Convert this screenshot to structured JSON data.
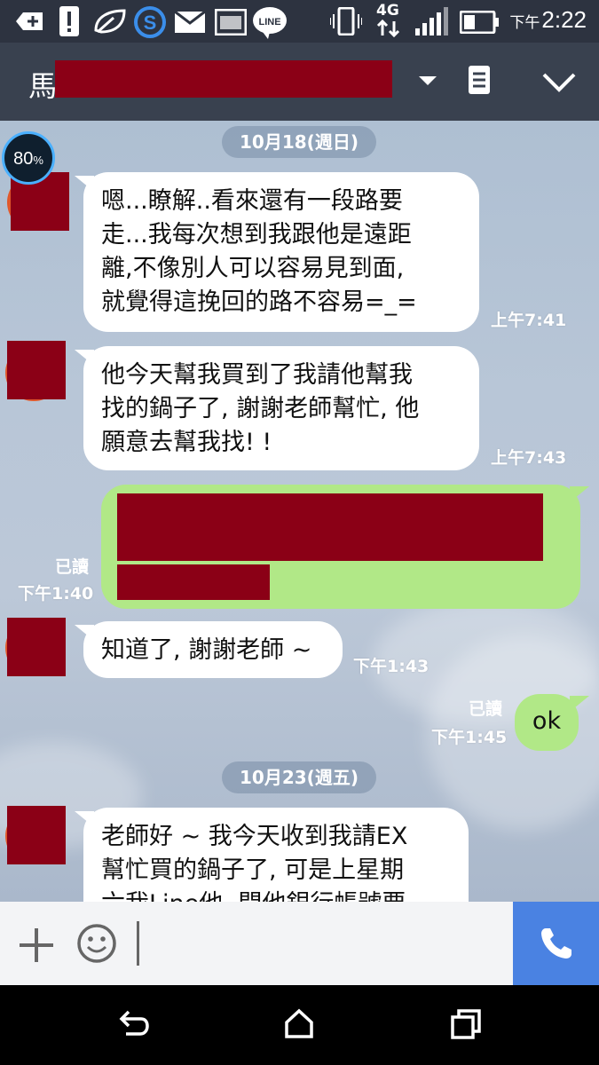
{
  "status_bar": {
    "network": "4G",
    "ampm": "下午",
    "time": "2:22",
    "icons": [
      "add-icon",
      "alert-icon",
      "leaf-icon",
      "s-app-icon",
      "mail-icon",
      "image-icon",
      "line-icon",
      "vibrate-icon",
      "signal-icon",
      "battery-icon"
    ]
  },
  "header": {
    "contact_name": "馬",
    "icons": [
      "dropdown-arrow-icon",
      "notes-icon",
      "chevron-down-icon"
    ]
  },
  "widget": {
    "battery": "80",
    "unit": "%"
  },
  "messages": [
    {
      "date": "10月18(週日)"
    },
    {
      "from": "them",
      "text_lines": [
        "嗯...瞭解..看來還有一段路要",
        "走...我每次想到我跟他是遠距",
        "離,不像別人可以容易見到面,",
        "就覺得這挽回的路不容易=_="
      ],
      "time": "上午7:41"
    },
    {
      "from": "them",
      "text_lines": [
        "他今天幫我買到了我請他幫我",
        "找的鍋子了, 謝謝老師幫忙, 他",
        "願意去幫我找! !"
      ],
      "time": "上午7:43"
    },
    {
      "from": "me",
      "read": "已讀",
      "time": "下午1:40"
    },
    {
      "from": "them",
      "text_lines": [
        "知道了, 謝謝老師 ~"
      ],
      "time": "下午1:43"
    },
    {
      "from": "me",
      "text_lines": [
        "ok"
      ],
      "read": "已讀",
      "time": "下午1:45"
    },
    {
      "date": "10月23(週五)"
    },
    {
      "from": "them",
      "text_lines": [
        "老師好 ~  我今天收到我請EX",
        "幫忙買的鍋子了, 可是上星期",
        "六我Line他, 問他銀行帳號要"
      ]
    }
  ],
  "input": {
    "icons": [
      "plus-icon",
      "emoji-icon",
      "phone-icon"
    ]
  },
  "nav": {
    "icons": [
      "back-icon",
      "home-icon",
      "recents-icon"
    ]
  }
}
